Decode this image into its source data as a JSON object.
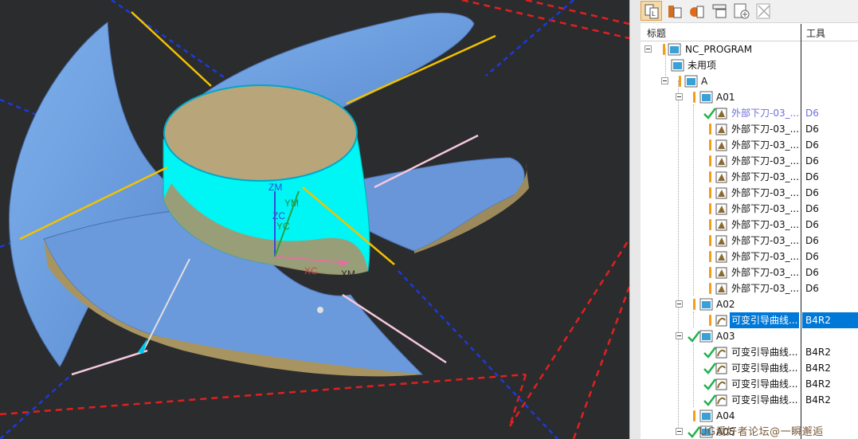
{
  "viewport": {
    "axis_labels": {
      "zm": "ZM",
      "ym": "YM",
      "zc": "ZC",
      "yc": "YC",
      "xc": "XC",
      "xm": "XM"
    }
  },
  "toolbar": {
    "buttons": [
      {
        "icon": "program-order-view-icon"
      },
      {
        "icon": "machine-tool-view-icon"
      },
      {
        "icon": "geometry-view-icon"
      },
      {
        "icon": "machining-method-view-icon"
      },
      {
        "icon": "add-column-icon"
      },
      {
        "icon": "delete-icon"
      }
    ]
  },
  "columns": {
    "name": "标题",
    "tool": "工具"
  },
  "tree": [
    {
      "label": "NC_PROGRAM",
      "tool": ""
    },
    {
      "label": "未用项",
      "tool": ""
    },
    {
      "label": "A",
      "tool": ""
    },
    {
      "label": "A01",
      "tool": ""
    },
    {
      "label": "外部下刀-03_...",
      "tool": "D6"
    },
    {
      "label": "外部下刀-03_...",
      "tool": "D6"
    },
    {
      "label": "外部下刀-03_...",
      "tool": "D6"
    },
    {
      "label": "外部下刀-03_...",
      "tool": "D6"
    },
    {
      "label": "外部下刀-03_...",
      "tool": "D6"
    },
    {
      "label": "外部下刀-03_...",
      "tool": "D6"
    },
    {
      "label": "外部下刀-03_...",
      "tool": "D6"
    },
    {
      "label": "外部下刀-03_...",
      "tool": "D6"
    },
    {
      "label": "外部下刀-03_...",
      "tool": "D6"
    },
    {
      "label": "外部下刀-03_...",
      "tool": "D6"
    },
    {
      "label": "外部下刀-03_...",
      "tool": "D6"
    },
    {
      "label": "外部下刀-03_...",
      "tool": "D6"
    },
    {
      "label": "A02",
      "tool": ""
    },
    {
      "label": "可变引导曲线...",
      "tool": "B4R2"
    },
    {
      "label": "A03",
      "tool": ""
    },
    {
      "label": "可变引导曲线...",
      "tool": "B4R2"
    },
    {
      "label": "可变引导曲线...",
      "tool": "B4R2"
    },
    {
      "label": "可变引导曲线...",
      "tool": "B4R2"
    },
    {
      "label": "可变引导曲线...",
      "tool": "B4R2"
    },
    {
      "label": "A04",
      "tool": ""
    },
    {
      "label": "A05",
      "tool": ""
    }
  ],
  "watermark": "UG爱好者论坛@一瞬邂逅",
  "colors": {
    "blade": "#6e9ee0",
    "hub_top": "#b5a277",
    "selected_face": "#00ffff",
    "selection": "#0078d7",
    "warning": "#f29d1c",
    "check": "#22b14c"
  }
}
